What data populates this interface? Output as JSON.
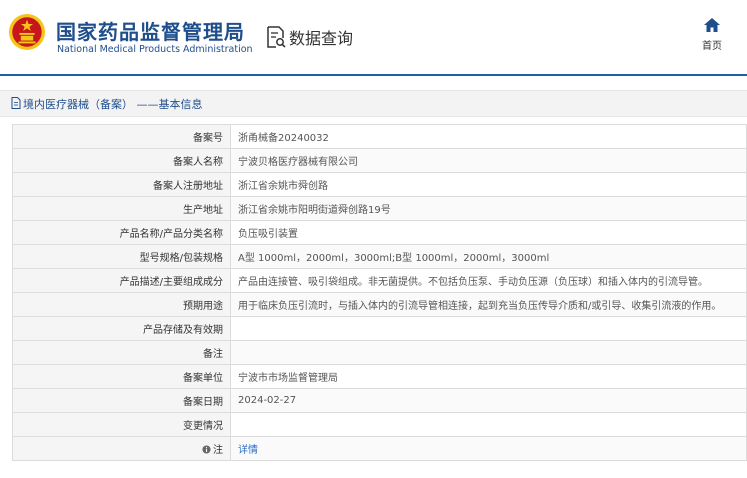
{
  "header": {
    "agency_cn": "国家药品监督管理局",
    "agency_en": "National Medical Products Administration",
    "query_label": "数据查询",
    "home_label": "首页"
  },
  "breadcrumb": "境内医疗器械（备案） ——基本信息",
  "record": {
    "rows": [
      {
        "label": "备案号",
        "value": "浙甬械备20240032"
      },
      {
        "label": "备案人名称",
        "value": "宁波贝格医疗器械有限公司"
      },
      {
        "label": "备案人注册地址",
        "value": "浙江省余姚市舜创路"
      },
      {
        "label": "生产地址",
        "value": "浙江省余姚市阳明街道舜创路19号"
      },
      {
        "label": "产品名称/产品分类名称",
        "value": "负压吸引装置"
      },
      {
        "label": "型号规格/包装规格",
        "value": "A型 1000ml，2000ml，3000ml;B型 1000ml，2000ml，3000ml"
      },
      {
        "label": "产品描述/主要组成成分",
        "value": "产品由连接管、吸引袋组成。非无菌提供。不包括负压泵、手动负压源（负压球）和插入体内的引流导管。"
      },
      {
        "label": "预期用途",
        "value": "用于临床负压引流时，与插入体内的引流导管相连接，起到充当负压传导介质和/或引导、收集引流液的作用。"
      },
      {
        "label": "产品存储及有效期",
        "value": ""
      },
      {
        "label": "备注",
        "value": ""
      },
      {
        "label": "备案单位",
        "value": "宁波市市场监督管理局"
      },
      {
        "label": "备案日期",
        "value": "2024-02-27"
      },
      {
        "label": "变更情况",
        "value": ""
      }
    ],
    "note_label": "注",
    "note_link": "详情"
  },
  "colors": {
    "brand_blue": "#1f4e8c",
    "rule_blue": "#1f5fa8",
    "link_blue": "#2b6cc4",
    "emblem_red": "#c8161d",
    "emblem_gold": "#f5c518"
  },
  "icons": {
    "emblem": "national-emblem-icon",
    "query": "document-search-icon",
    "home": "home-icon",
    "breadcrumb": "document-icon",
    "note": "info-icon"
  }
}
